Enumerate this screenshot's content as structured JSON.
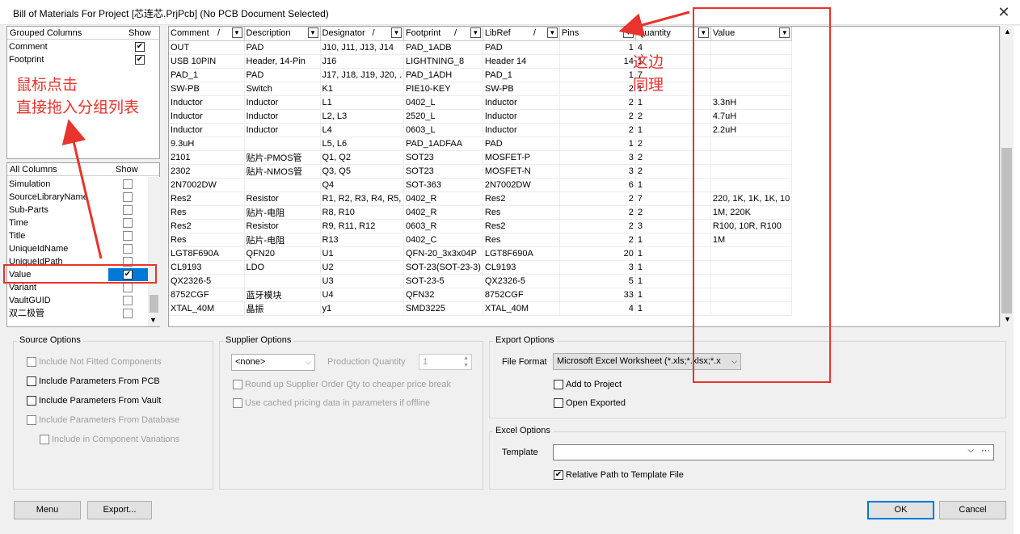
{
  "window": {
    "title": "Bill of Materials For Project [芯连芯.PrjPcb] (No PCB Document Selected)",
    "close_glyph": "✕"
  },
  "grouped_columns": {
    "header_left": "Grouped Columns",
    "header_right": "Show",
    "items": [
      {
        "label": "Comment",
        "checked": true
      },
      {
        "label": "Footprint",
        "checked": true
      }
    ]
  },
  "all_columns": {
    "header_left": "All Columns",
    "header_right": "Show",
    "items": [
      {
        "label": "Simulation",
        "checked": false
      },
      {
        "label": "SourceLibraryName",
        "checked": false
      },
      {
        "label": "Sub-Parts",
        "checked": false
      },
      {
        "label": "Time",
        "checked": false
      },
      {
        "label": "Title",
        "checked": false
      },
      {
        "label": "UniqueIdName",
        "checked": false
      },
      {
        "label": "UniqueIdPath",
        "checked": false
      },
      {
        "label": "Value",
        "checked": true,
        "selected": true
      },
      {
        "label": "Variant",
        "checked": false
      },
      {
        "label": "VaultGUID",
        "checked": false
      },
      {
        "label": "双二极管",
        "checked": false
      }
    ]
  },
  "table": {
    "columns": [
      "Comment",
      "Description",
      "Designator",
      "Footprint",
      "LibRef",
      "Pins",
      "Quantity",
      "Value"
    ],
    "sort_glyph": "/",
    "rows": [
      [
        "OUT",
        "PAD",
        "J10, J11, J13, J14",
        "PAD_1ADB",
        "PAD",
        "1",
        "4",
        ""
      ],
      [
        "USB 10PIN",
        "Header, 14-Pin",
        "J16",
        "LIGHTNING_8",
        "Header 14",
        "14",
        "1",
        ""
      ],
      [
        "PAD_1",
        "PAD",
        "J17, J18, J19, J20, .",
        "PAD_1ADH",
        "PAD_1",
        "1",
        "7",
        ""
      ],
      [
        "SW-PB",
        "Switch",
        "K1",
        "PIE10-KEY",
        "SW-PB",
        "2",
        "1",
        ""
      ],
      [
        "Inductor",
        "Inductor",
        "L1",
        "0402_L",
        "Inductor",
        "2",
        "1",
        "3.3nH"
      ],
      [
        "Inductor",
        "Inductor",
        "L2, L3",
        "2520_L",
        "Inductor",
        "2",
        "2",
        "4.7uH"
      ],
      [
        "Inductor",
        "Inductor",
        "L4",
        "0603_L",
        "Inductor",
        "2",
        "1",
        "2.2uH"
      ],
      [
        "9.3uH",
        "",
        "L5, L6",
        "PAD_1ADFAA",
        "PAD",
        "1",
        "2",
        ""
      ],
      [
        "2101",
        "贴片-PMOS管",
        "Q1, Q2",
        "SOT23",
        "MOSFET-P",
        "3",
        "2",
        ""
      ],
      [
        "2302",
        "贴片-NMOS管",
        "Q3, Q5",
        "SOT23",
        "MOSFET-N",
        "3",
        "2",
        ""
      ],
      [
        "2N7002DW",
        "",
        "Q4",
        "SOT-363",
        "2N7002DW",
        "6",
        "1",
        ""
      ],
      [
        "Res2",
        "Resistor",
        "R1, R2, R3, R4, R5,",
        "0402_R",
        "Res2",
        "2",
        "7",
        "220, 1K, 1K, 1K, 10"
      ],
      [
        "Res",
        "贴片-电阻",
        "R8, R10",
        "0402_R",
        "Res",
        "2",
        "2",
        "1M, 220K"
      ],
      [
        "Res2",
        "Resistor",
        "R9, R11, R12",
        "0603_R",
        "Res2",
        "2",
        "3",
        "R100, 10R, R100"
      ],
      [
        "Res",
        "贴片-电阻",
        "R13",
        "0402_C",
        "Res",
        "2",
        "1",
        "1M"
      ],
      [
        "LGT8F690A",
        "QFN20",
        "U1",
        "QFN-20_3x3x04P",
        "LGT8F690A",
        "20",
        "1",
        ""
      ],
      [
        "CL9193",
        "LDO",
        "U2",
        "SOT-23(SOT-23-3)",
        "CL9193",
        "3",
        "1",
        ""
      ],
      [
        "QX2326-5",
        "",
        "U3",
        "SOT-23-5",
        "QX2326-5",
        "5",
        "1",
        ""
      ],
      [
        "8752CGF",
        "蓝牙模块",
        "U4",
        "QFN32",
        "8752CGF",
        "33",
        "1",
        ""
      ],
      [
        "XTAL_40M",
        "晶振",
        "y1",
        "SMD3225",
        "XTAL_40M",
        "4",
        "1",
        ""
      ]
    ]
  },
  "source_options": {
    "title": "Source Options",
    "items": [
      {
        "label": "Include Not Fitted Components",
        "enabled": false
      },
      {
        "label": "Include Parameters From PCB",
        "enabled": true
      },
      {
        "label": "Include Parameters From Vault",
        "enabled": true
      },
      {
        "label": "Include Parameters From Database",
        "enabled": false
      },
      {
        "label": "Include in Component Variations",
        "enabled": false
      }
    ]
  },
  "supplier_options": {
    "title": "Supplier Options",
    "supplier_value": "<none>",
    "quantity_label": "Production Quantity",
    "quantity_value": "1",
    "round_up_label": "Round up Supplier Order Qty to cheaper price break",
    "cached_label": "Use cached pricing data in parameters if offline"
  },
  "export_options": {
    "title": "Export Options",
    "file_format_label": "File Format",
    "file_format_value": "Microsoft Excel Worksheet (*.xls;*.xlsx;*.x",
    "add_to_project": "Add to Project",
    "open_exported": "Open Exported"
  },
  "excel_options": {
    "title": "Excel Options",
    "template_label": "Template",
    "template_value": "",
    "relative_path_label": "Relative Path to Template File",
    "relative_path_checked": true
  },
  "buttons": {
    "menu": "Menu",
    "export": "Export...",
    "ok": "OK",
    "cancel": "Cancel"
  },
  "annotations": {
    "left_note_line1": "鼠标点击",
    "left_note_line2": "直接拖入分组列表",
    "right_note_line1": "这边",
    "right_note_line2": "同理",
    "color": "#e8342c"
  }
}
